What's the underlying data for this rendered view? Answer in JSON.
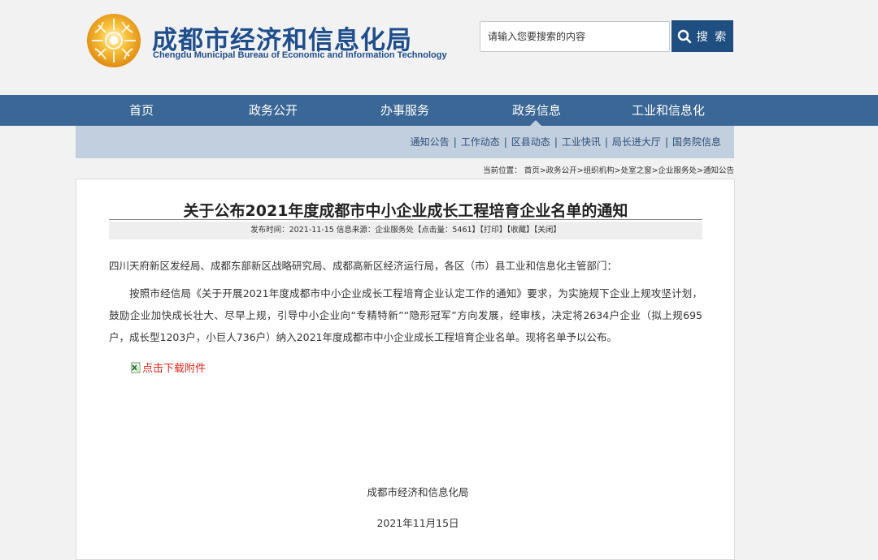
{
  "header": {
    "org_name_cn": "成都市经济和信息化局",
    "org_name_en": "Chengdu Municipal Bureau of Economic and Information Technology",
    "search_placeholder": "请输入您要搜索的内容",
    "search_button": "搜 索",
    "brand_color": "#1f4e8c"
  },
  "nav": {
    "items": [
      "首页",
      "政务公开",
      "办事服务",
      "政务信息",
      "工业和信息化"
    ],
    "active": "政务信息"
  },
  "subnav": {
    "items": [
      "通知公告",
      "工作动态",
      "区县动态",
      "工业快讯",
      "局长进大厅",
      "国务院信息"
    ]
  },
  "breadcrumb": "当前位置： 首页>政务公开>组织机构>处室之窗>企业服务处>通知公告",
  "article": {
    "title": "关于公布2021年度成都市中小企业成长工程培育企业名单的通知",
    "meta_prefix": "发布时间：2021-11-15 信息来源：企业服务处【点击量：5461】",
    "meta_print": "【打印】",
    "meta_favorite": "【收藏】",
    "meta_close": "【关闭】",
    "recipients": "四川天府新区发经局、成都东部新区战略研究局、成都高新区经济运行局，各区（市）县工业和信息化主管部门：",
    "body": "按照市经信局《关于开展2021年度成都市中小企业成长工程培育企业认定工作的通知》要求，为实施规下企业上规攻坚计划，鼓励企业加快成长壮大、尽早上规，引导中小企业向“专精特新”“隐形冠军”方向发展，经审核，决定将2634户企业（拟上规695户，成长型1203户，小巨人736户）纳入2021年度成都市中小企业成长工程培育企业名单。现将名单予以公布。",
    "download_label": "点击下载附件",
    "signer": "成都市经济和信息化局",
    "date": "2021年11月15日"
  }
}
